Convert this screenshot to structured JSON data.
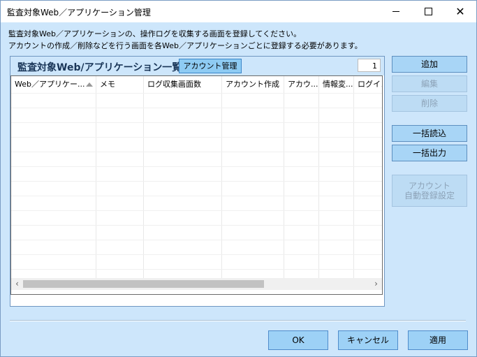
{
  "window": {
    "title": "監査対象Web／アプリケーション管理"
  },
  "description": {
    "line1": "監査対象Web／アプリケーションの、操作ログを収集する画面を登録してください。",
    "line2": "アカウントの作成／削除などを行う画面を各Web／アプリケーションごとに登録する必要があります。"
  },
  "panel": {
    "title": "監査対象Web/アプリケーション一覧",
    "account_button": "アカウント管理",
    "count": "1"
  },
  "grid": {
    "columns": [
      "Web／アプリケー...",
      "メモ",
      "ログ収集画面数",
      "アカウント作成",
      "アカウ...",
      "情報変...",
      "ログイン"
    ]
  },
  "side_buttons": {
    "add": "追加",
    "edit": "編集",
    "delete": "削除",
    "bulk_import": "一括読込",
    "bulk_export": "一括出力",
    "auto_reg_line1": "アカウント",
    "auto_reg_line2": "自動登録設定"
  },
  "footer": {
    "ok": "OK",
    "cancel": "キャンセル",
    "apply": "適用"
  },
  "colors": {
    "background": "#cde6fb",
    "button": "#a8d5f6",
    "button_disabled": "#bddcf4",
    "border": "#5d8fc0"
  },
  "icons": [
    "minimize-icon",
    "maximize-icon",
    "close-icon",
    "sort-ascending-icon",
    "scroll-left-icon",
    "scroll-right-icon"
  ]
}
